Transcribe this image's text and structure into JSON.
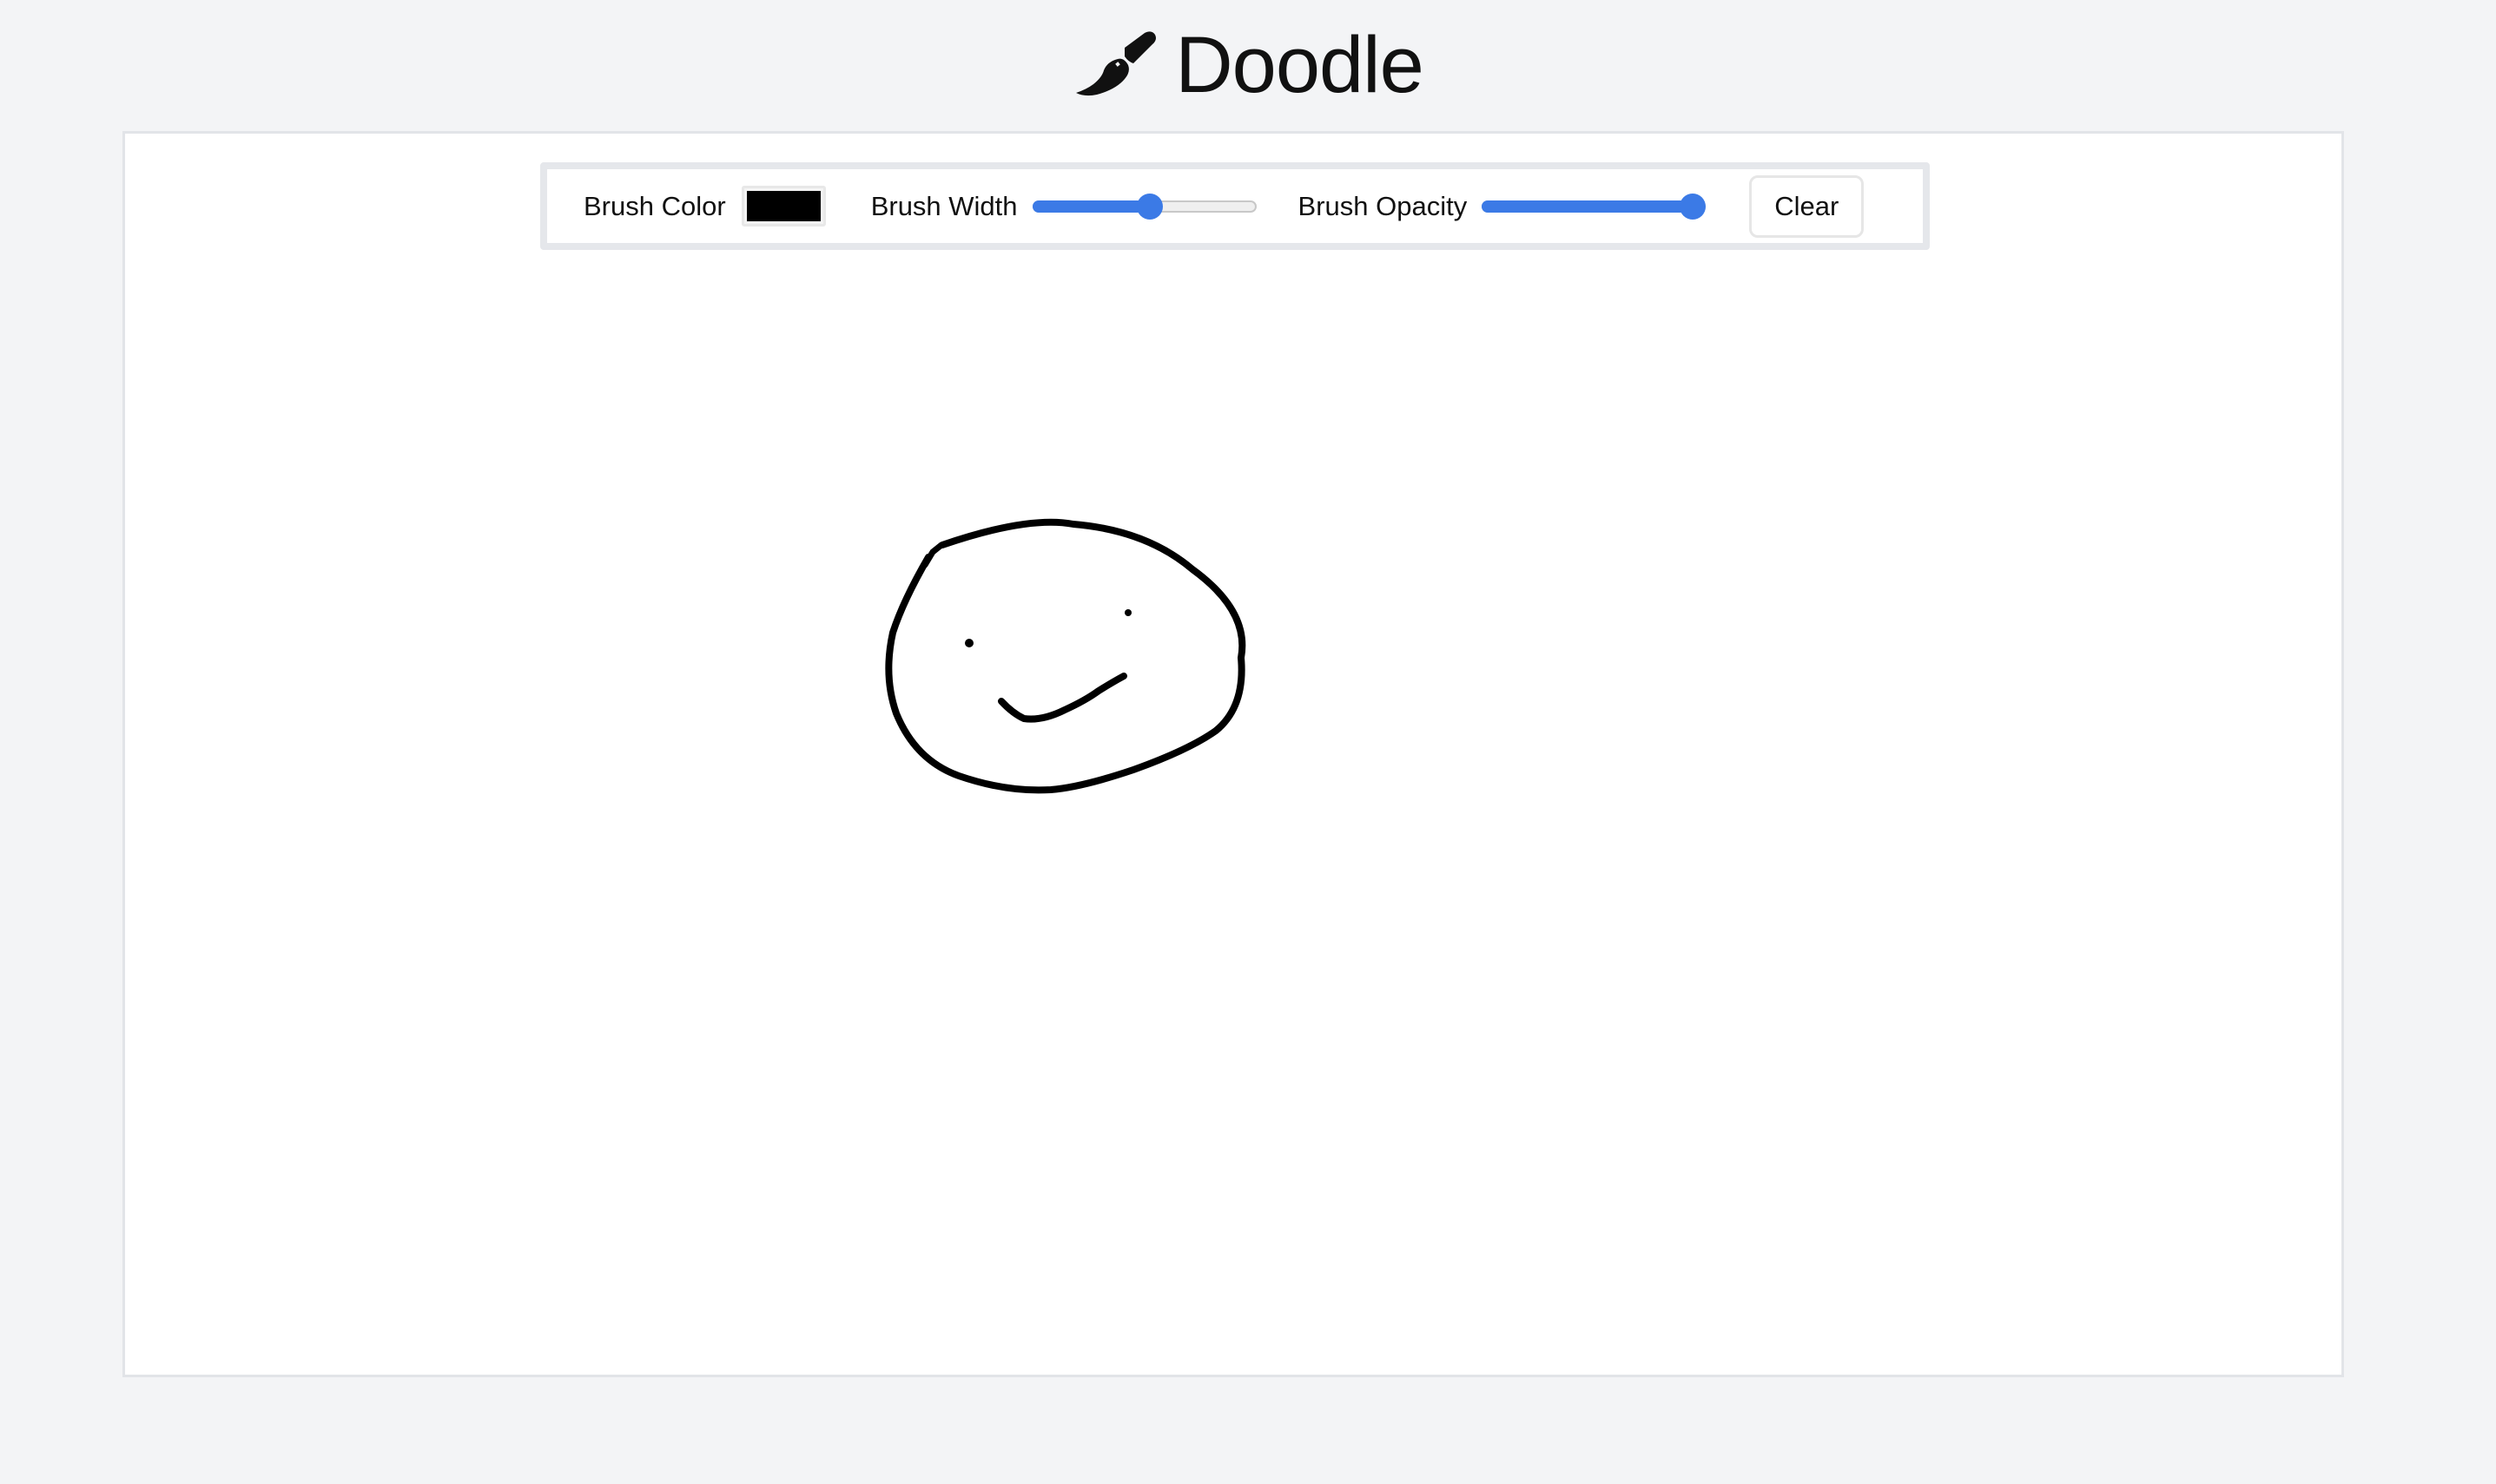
{
  "app": {
    "title": "Doodle",
    "icon": "paint-brush-icon"
  },
  "toolbar": {
    "brush_color_label": "Brush Color",
    "brush_color_value": "#000000",
    "brush_width_label": "Brush Width",
    "brush_width_fraction": 0.53,
    "brush_opacity_label": "Brush Opacity",
    "brush_opacity_fraction": 1.0,
    "clear_label": "Clear"
  },
  "colors": {
    "accent": "#3b7ae6",
    "page_background": "#f3f4f6",
    "canvas_background": "#ffffff",
    "stroke": "#000000"
  }
}
